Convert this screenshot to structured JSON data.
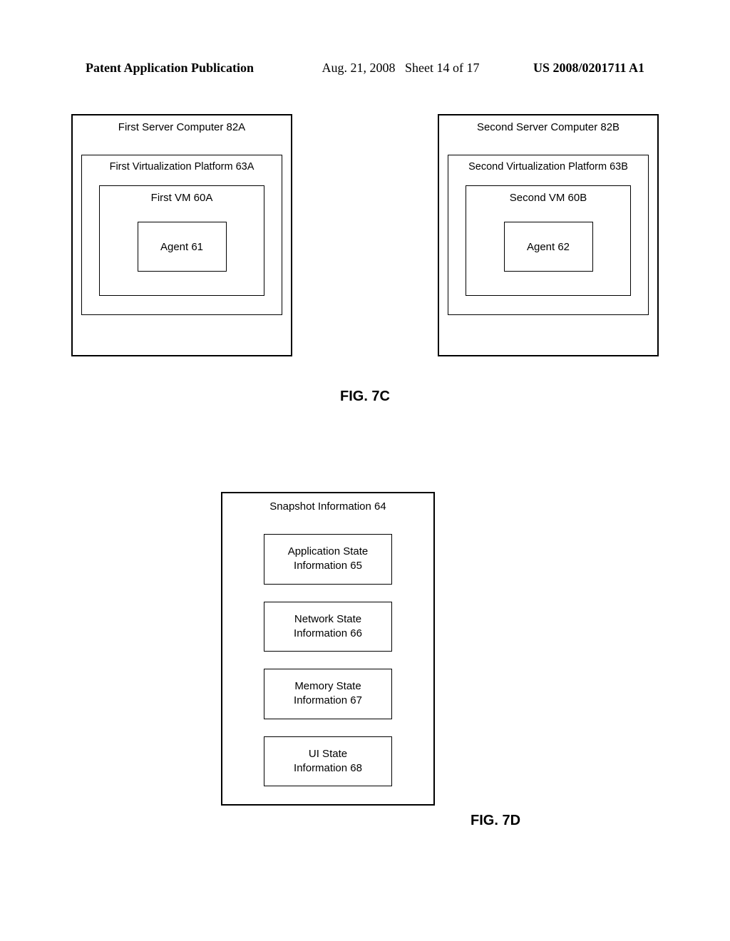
{
  "header": {
    "left": "Patent Application Publication",
    "date": "Aug. 21, 2008",
    "sheet": "Sheet 14 of 17",
    "pubnum": "US 2008/0201711 A1"
  },
  "fig7c": {
    "label": "FIG. 7C",
    "servers": [
      {
        "title": "First Server Computer 82A",
        "platform": "First Virtualization Platform 63A",
        "vm": "First VM 60A",
        "agent": "Agent 61"
      },
      {
        "title": "Second Server Computer 82B",
        "platform": "Second Virtualization Platform 63B",
        "vm": "Second VM 60B",
        "agent": "Agent 62"
      }
    ]
  },
  "fig7d": {
    "label": "FIG. 7D",
    "snapshot_title": "Snapshot Information 64",
    "states": [
      {
        "line1": "Application State",
        "line2": "Information 65"
      },
      {
        "line1": "Network State",
        "line2": "Information 66"
      },
      {
        "line1": "Memory State",
        "line2": "Information 67"
      },
      {
        "line1": "UI State",
        "line2": "Information 68"
      }
    ]
  }
}
